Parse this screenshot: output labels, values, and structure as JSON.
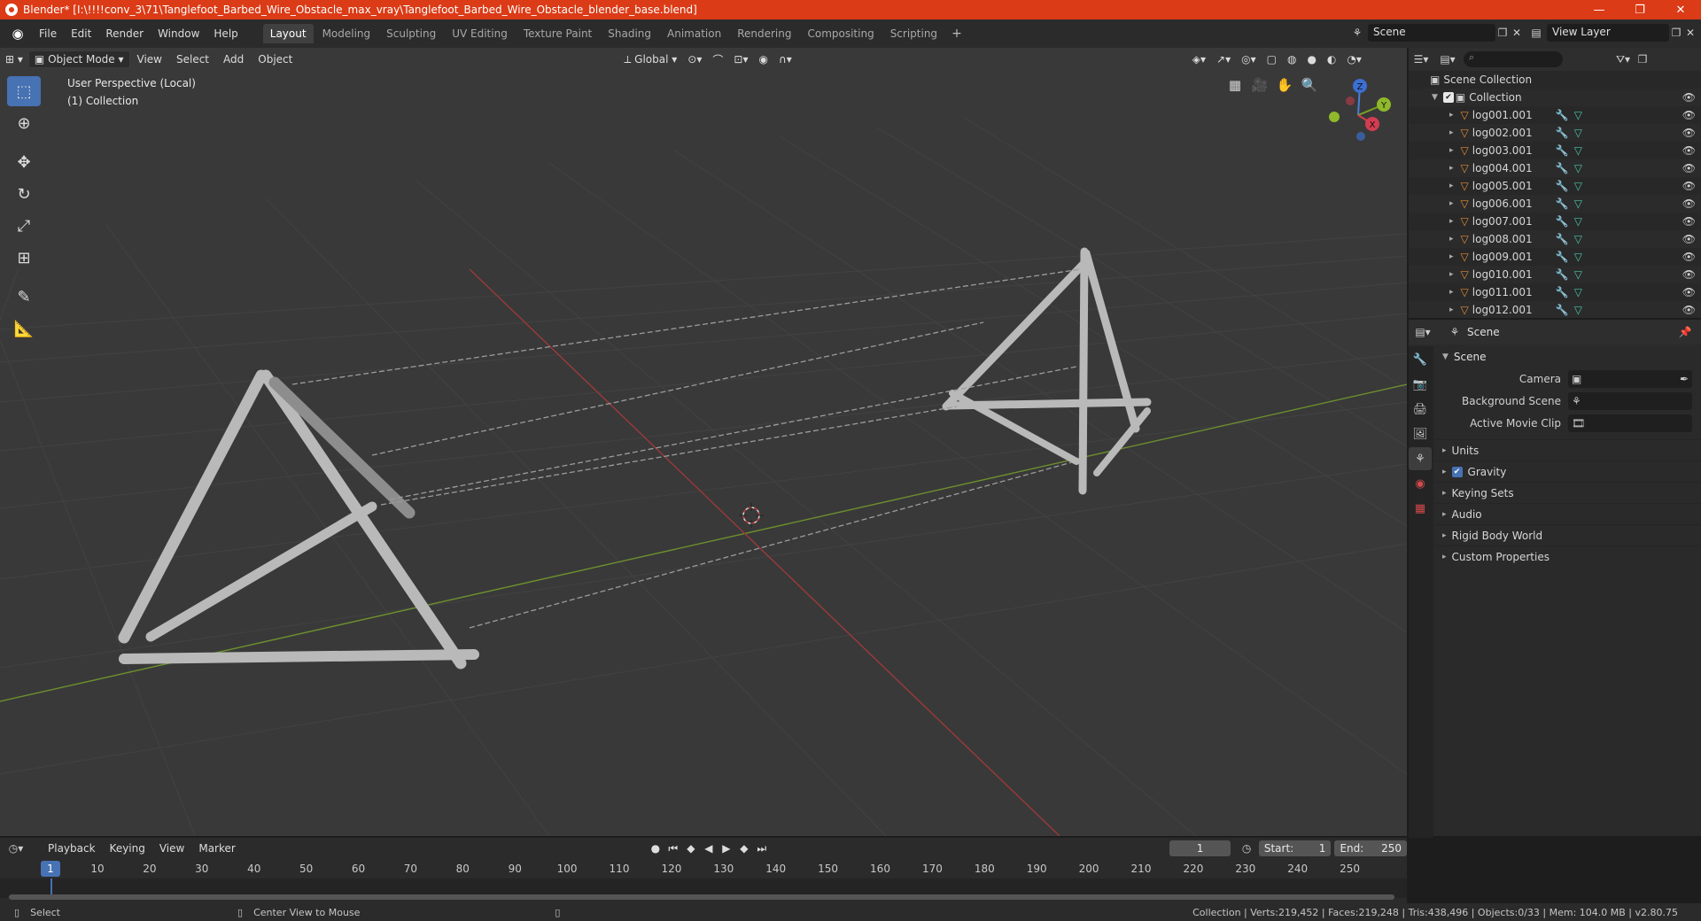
{
  "window": {
    "title": "Blender* [I:\\!!!!conv_3\\71\\Tanglefoot_Barbed_Wire_Obstacle_max_vray\\Tanglefoot_Barbed_Wire_Obstacle_blender_base.blend]",
    "minimize": "—",
    "maximize": "❐",
    "close": "✕"
  },
  "menu": [
    "File",
    "Edit",
    "Render",
    "Window",
    "Help"
  ],
  "workspaces": [
    "Layout",
    "Modeling",
    "Sculpting",
    "UV Editing",
    "Texture Paint",
    "Shading",
    "Animation",
    "Rendering",
    "Compositing",
    "Scripting"
  ],
  "active_workspace": "Layout",
  "scene_name": "Scene",
  "view_layer": "View Layer",
  "viewport": {
    "mode": "Object Mode",
    "menus": [
      "View",
      "Select",
      "Add",
      "Object"
    ],
    "transform_orientation": "Global",
    "perspective_label": "User Perspective (Local)",
    "collection_label": "(1) Collection",
    "gizmo": {
      "x": "X",
      "y": "Y",
      "z": "Z"
    }
  },
  "outliner": {
    "root": "Scene Collection",
    "collection": "Collection",
    "objects": [
      "log001.001",
      "log002.001",
      "log003.001",
      "log004.001",
      "log005.001",
      "log006.001",
      "log007.001",
      "log008.001",
      "log009.001",
      "log010.001",
      "log011.001",
      "log012.001"
    ]
  },
  "properties": {
    "context": "Scene",
    "panel": "Scene",
    "fields": [
      {
        "label": "Camera"
      },
      {
        "label": "Background Scene"
      },
      {
        "label": "Active Movie Clip"
      }
    ],
    "subpanels": [
      "Units",
      "Gravity",
      "Keying Sets",
      "Audio",
      "Rigid Body World",
      "Custom Properties"
    ],
    "gravity_checked": true
  },
  "timeline": {
    "menus": [
      "Playback",
      "Keying",
      "View",
      "Marker"
    ],
    "current_frame": "1",
    "start_label": "Start:",
    "start": "1",
    "end_label": "End:",
    "end": "250",
    "ticks": [
      "10",
      "20",
      "30",
      "40",
      "50",
      "60",
      "70",
      "80",
      "90",
      "100",
      "110",
      "120",
      "130",
      "140",
      "150",
      "160",
      "170",
      "180",
      "190",
      "200",
      "210",
      "220",
      "230",
      "240",
      "250"
    ]
  },
  "statusbar": {
    "left_action": "Select",
    "middle_action": "Center View to Mouse",
    "stats": "Collection | Verts:219,452 | Faces:219,248 | Tris:438,496 | Objects:0/33 | Mem: 104.0 MB | v2.80.75"
  }
}
